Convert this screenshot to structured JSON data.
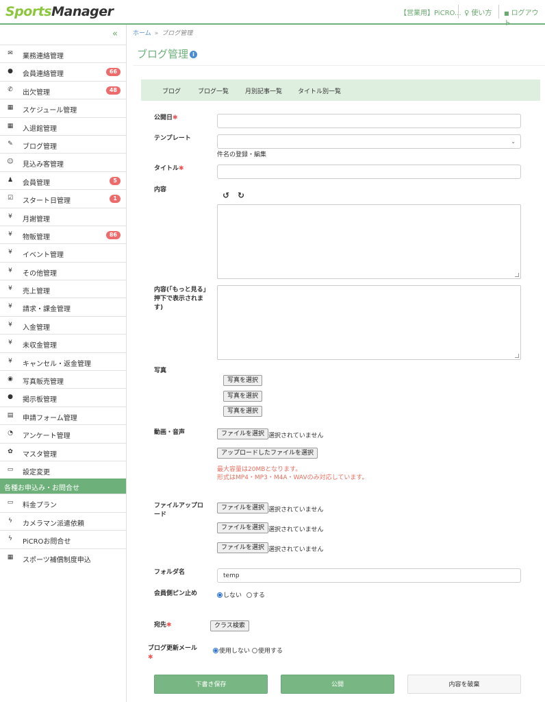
{
  "header": {
    "logo_sports": "Sports",
    "logo_manager": "Manager",
    "org": "【営業用】PiCRO...",
    "help": "使い方",
    "logout": "ログアウト"
  },
  "sidebar": {
    "collapse": "«",
    "items": [
      {
        "icon": "✉",
        "icon_name": "envelope-icon",
        "label": "業務連絡管理"
      },
      {
        "icon": "●",
        "icon_name": "chat-bubble-icon",
        "label": "会員連絡管理",
        "badge": "66"
      },
      {
        "icon": "✆",
        "icon_name": "phone-icon",
        "label": "出欠管理",
        "badge": "48"
      },
      {
        "icon": "▦",
        "icon_name": "calendar-icon",
        "label": "スケジュール管理"
      },
      {
        "icon": "▦",
        "icon_name": "calendar-icon",
        "label": "入退館管理"
      },
      {
        "icon": "✎",
        "icon_name": "pencil-icon",
        "label": "ブログ管理"
      },
      {
        "icon": "☺",
        "icon_name": "smile-icon",
        "label": "見込み客管理"
      },
      {
        "icon": "♟",
        "icon_name": "user-icon",
        "label": "会員管理",
        "badge": "5"
      },
      {
        "icon": "☑",
        "icon_name": "checkbox-icon",
        "label": "スタート日管理",
        "badge": "1"
      },
      {
        "icon": "¥",
        "icon_name": "yen-icon",
        "label": "月謝管理"
      },
      {
        "icon": "¥",
        "icon_name": "yen-icon",
        "label": "物販管理",
        "badge": "86"
      },
      {
        "icon": "¥",
        "icon_name": "yen-icon",
        "label": "イベント管理"
      },
      {
        "icon": "¥",
        "icon_name": "yen-icon",
        "label": "その他管理"
      },
      {
        "icon": "¥",
        "icon_name": "yen-icon",
        "label": "売上管理"
      },
      {
        "icon": "¥",
        "icon_name": "yen-icon",
        "label": "請求・課金管理"
      },
      {
        "icon": "¥",
        "icon_name": "yen-icon",
        "label": "入金管理"
      },
      {
        "icon": "¥",
        "icon_name": "yen-icon",
        "label": "未収金管理"
      },
      {
        "icon": "¥",
        "icon_name": "yen-icon",
        "label": "キャンセル・返金管理"
      },
      {
        "icon": "◉",
        "icon_name": "camera-icon",
        "label": "写真販売管理"
      },
      {
        "icon": "●",
        "icon_name": "chat-bubble-icon",
        "label": "掲示板管理"
      },
      {
        "icon": "▤",
        "icon_name": "document-icon",
        "label": "申請フォーム管理"
      },
      {
        "icon": "◔",
        "icon_name": "dashboard-icon",
        "label": "アンケート管理"
      },
      {
        "icon": "✿",
        "icon_name": "gear-icon",
        "label": "マスタ管理"
      },
      {
        "icon": "▭",
        "icon_name": "monitor-icon",
        "label": "設定変更"
      }
    ],
    "section_title": "各種お申込み・お問合せ",
    "section_items": [
      {
        "icon": "▭",
        "icon_name": "monitor-icon",
        "label": "料金プラン"
      },
      {
        "icon": "ϟ",
        "icon_name": "bolt-icon",
        "label": "カメラマン派遣依頼"
      },
      {
        "icon": "ϟ",
        "icon_name": "bolt-icon",
        "label": "PiCROお問合せ"
      },
      {
        "icon": "▦",
        "icon_name": "calendar-icon",
        "label": "スポーツ補償制度申込"
      }
    ]
  },
  "breadcrumb": {
    "home": "ホーム",
    "sep": "»",
    "current": "ブログ管理"
  },
  "page_title": "ブログ管理",
  "tabs": [
    "ブログ",
    "ブログ一覧",
    "月別記事一覧",
    "タイトル別一覧"
  ],
  "form": {
    "publish_date_label": "公開日",
    "required_mark": "✱",
    "template_label": "テンプレート",
    "template_help": "件名の登録・編集",
    "title_label": "タイトル",
    "content_label": "内容",
    "more_content_label": "内容(「もっと見る」押下で表示されます)",
    "photo_label": "写真",
    "photo_button": "写真を選択",
    "media_label": "動画・音声",
    "file_button": "ファイルを選択",
    "no_file": "選択されていません",
    "uploaded_button": "アップロードしたファイルを選択",
    "warn_size": "最大容量は20MBとなります。",
    "warn_format": "形式はMP4・MP3・M4A・WAVのみ対応しています。",
    "file_upload_label": "ファイルアップロード",
    "folder_label": "フォルダ名",
    "folder_value": "temp",
    "pin_label": "会員側ピン止め",
    "pin_options": [
      "しない",
      "する"
    ],
    "dest_label": "宛先",
    "class_search": "クラス検索",
    "mail_label": "ブログ更新メール",
    "mail_options": [
      "使用しない",
      "使用する"
    ]
  },
  "actions": {
    "draft": "下書き保存",
    "publish": "公開",
    "discard": "内容を破棄"
  },
  "colors": {
    "brand_green": "#6db07a",
    "badge_red": "#ee6b6b",
    "warn": "#e86e5e",
    "link_blue": "#5b8ed6"
  }
}
